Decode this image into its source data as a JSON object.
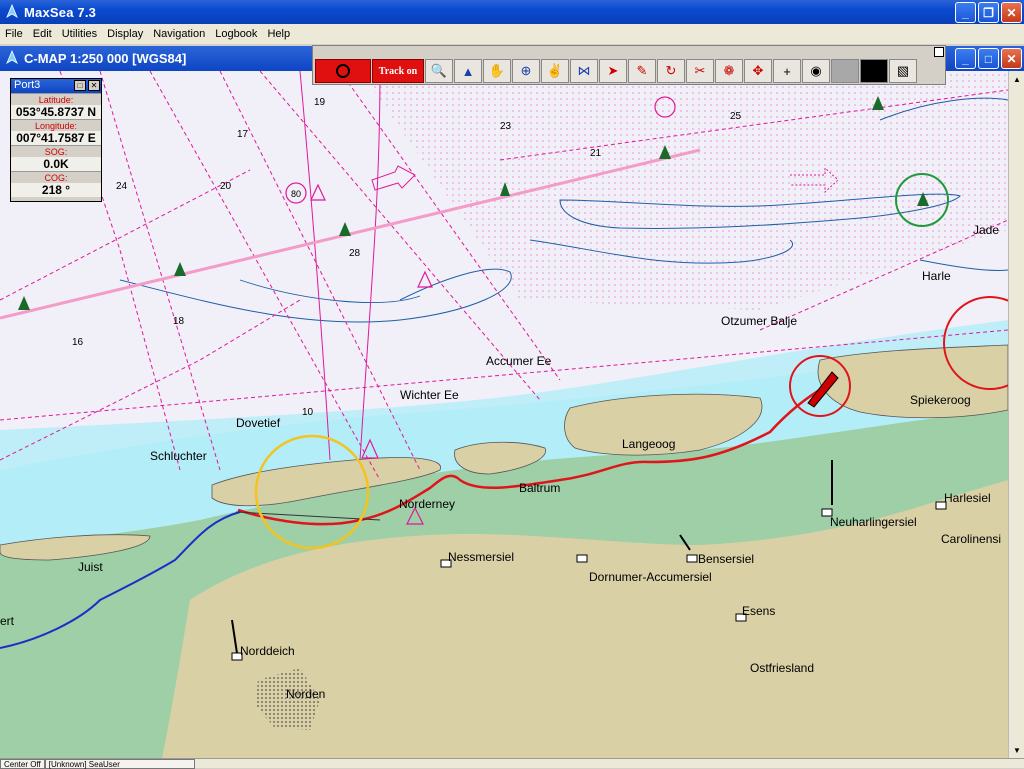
{
  "app": {
    "title": "MaxSea 7.3"
  },
  "menu": [
    "File",
    "Edit",
    "Utilities",
    "Display",
    "Navigation",
    "Logbook",
    "Help"
  ],
  "chart_window": {
    "title": "C-MAP  1:250 000 [WGS84]"
  },
  "toolbar": {
    "track_label": "Track on"
  },
  "info_panel": {
    "title": "Port3",
    "fields": [
      {
        "label": "Latitude:",
        "value": "053°45.8737 N"
      },
      {
        "label": "Longitude:",
        "value": "007°41.7587 E"
      },
      {
        "label": "SOG:",
        "value": "0.0K"
      },
      {
        "label": "COG:",
        "value": "218 °"
      }
    ]
  },
  "places": [
    {
      "key": "jade",
      "name": "Jade"
    },
    {
      "key": "harle",
      "name": "Harle"
    },
    {
      "key": "otzumer",
      "name": "Otzumer Balje"
    },
    {
      "key": "accumer",
      "name": "Accumer Ee"
    },
    {
      "key": "wichter",
      "name": "Wichter Ee"
    },
    {
      "key": "dovetief",
      "name": "Dovetief"
    },
    {
      "key": "schluchter",
      "name": "Schluchter"
    },
    {
      "key": "langeoog",
      "name": "Langeoog"
    },
    {
      "key": "spiekeroog",
      "name": "Spiekeroog"
    },
    {
      "key": "baltrum",
      "name": "Baltrum"
    },
    {
      "key": "norderney",
      "name": "Norderney"
    },
    {
      "key": "harlesiel",
      "name": "Harlesiel"
    },
    {
      "key": "neuharlingersiel",
      "name": "Neuharlingersiel"
    },
    {
      "key": "carolinensiel",
      "name": "Carolinensi"
    },
    {
      "key": "nessmersiel",
      "name": "Nessmersiel"
    },
    {
      "key": "bensersiel",
      "name": "Bensersiel"
    },
    {
      "key": "dornumer",
      "name": "Dornumer-Accumersiel"
    },
    {
      "key": "esens",
      "name": "Esens"
    },
    {
      "key": "juist",
      "name": "Juist"
    },
    {
      "key": "norddeich",
      "name": "Norddeich"
    },
    {
      "key": "norden",
      "name": "Norden"
    },
    {
      "key": "ostfriesland",
      "name": "Ostfriesland"
    },
    {
      "key": "ert",
      "name": "ert"
    }
  ],
  "soundings": [
    "23",
    "21",
    "20",
    "18",
    "17",
    "16",
    "24",
    "25",
    "19",
    "10",
    "80",
    "28"
  ],
  "status": {
    "cell1": "Center Off",
    "cell2": "[Unknown] SeaUser"
  },
  "colors": {
    "land": "#d9d0a6",
    "intertidal": "#9ecfa6",
    "shallow": "#b3eef8",
    "deep": "#f1eff8",
    "magenta": "#e0199a",
    "track": "#e0141a",
    "route": "#1a2fc8"
  }
}
